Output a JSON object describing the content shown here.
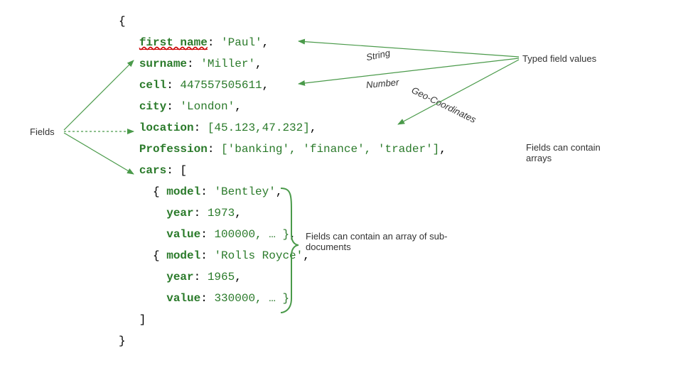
{
  "labels": {
    "fields": "Fields",
    "typed_values": "Typed field values",
    "type_string": "String",
    "type_number": "Number",
    "type_geo": "Geo-Coordinates",
    "arrays_note": "Fields can contain arrays",
    "subdoc_note": "Fields can contain an array of sub-documents"
  },
  "doc": {
    "first_name_key": "first name",
    "first_name_val": "'Paul'",
    "surname_key": "surname",
    "surname_val": "'Miller'",
    "cell_key": "cell",
    "cell_val": "447557505611",
    "city_key": "city",
    "city_val": "'London'",
    "location_key": "location",
    "location_val": "[45.123,47.232]",
    "profession_key": "Profession",
    "profession_val": "['banking', 'finance', 'trader']",
    "cars_key": "cars",
    "car1_model_key": "model",
    "car1_model_val": "'Bentley'",
    "car1_year_key": "year",
    "car1_year_val": "1973",
    "car1_value_key": "value",
    "car1_value_val": "100000, … }",
    "car2_model_key": "model",
    "car2_model_val": "'Rolls Royce'",
    "car2_year_key": "year",
    "car2_year_val": "1965",
    "car2_value_key": "value",
    "car2_value_val": "330000, … }"
  }
}
